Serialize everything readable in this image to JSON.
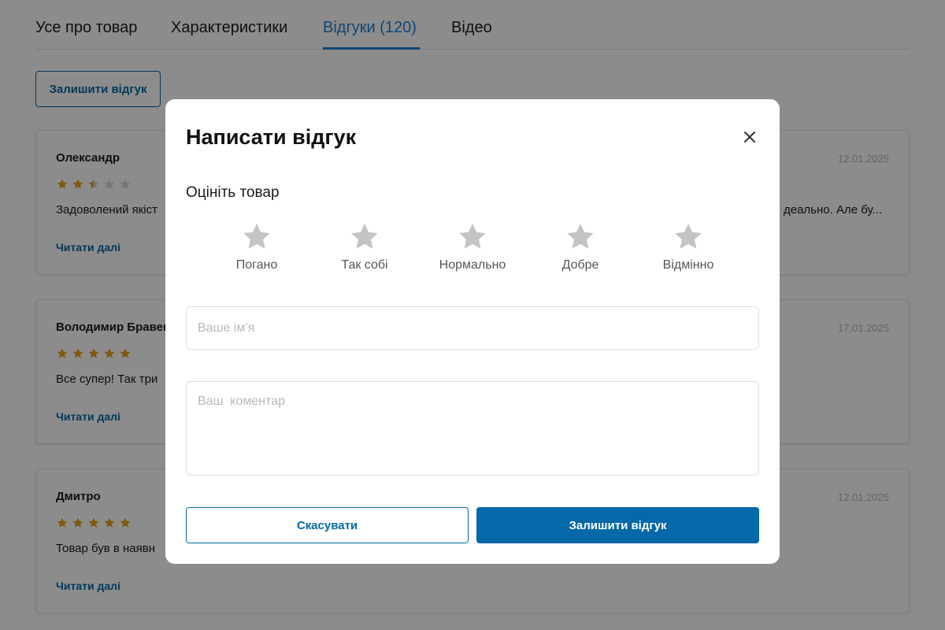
{
  "tabs": [
    {
      "label": "Усе про товар"
    },
    {
      "label": "Характеристики"
    },
    {
      "label": "Відгуки (120)",
      "active": true
    },
    {
      "label": "Відео"
    }
  ],
  "leave_review_button": "Залишити відгук",
  "reviews": [
    {
      "author": "Олександр",
      "date": "12.01.2025",
      "rating": 2.5,
      "text": "Задоволений якіст",
      "text_end": "деально. Але бу...",
      "read_more": "Читати далі"
    },
    {
      "author": "Володимир Бравен",
      "date": "17.01.2025",
      "rating": 5,
      "text": "Все супер! Так три",
      "text_end": "",
      "read_more": "Читати далі"
    },
    {
      "author": "Дмитро",
      "date": "12.01.2025",
      "rating": 5,
      "text": "Товар був в наявн",
      "text_end": "",
      "read_more": "Читати далі"
    }
  ],
  "modal": {
    "title": "Написати відгук",
    "close_icon": "close-icon",
    "rate_label": "Оцініть товар",
    "rating_options": [
      {
        "label": "Погано"
      },
      {
        "label": "Так собі"
      },
      {
        "label": "Нормально"
      },
      {
        "label": "Добре"
      },
      {
        "label": "Відмінно"
      }
    ],
    "name_placeholder": "Ваше ім’я",
    "name_value": "",
    "comment_placeholder": "Ваш  коментар",
    "comment_value": "",
    "cancel_label": "Скасувати",
    "submit_label": "Залишити відгук"
  },
  "colors": {
    "accent": "#0568a8",
    "tab_active": "#1b7fd3",
    "star_filled": "#e8a21b",
    "star_empty": "#d9d9d9",
    "star_rating_option": "#c4c4c4",
    "overlay": "rgba(0,0,0,0.45)"
  }
}
